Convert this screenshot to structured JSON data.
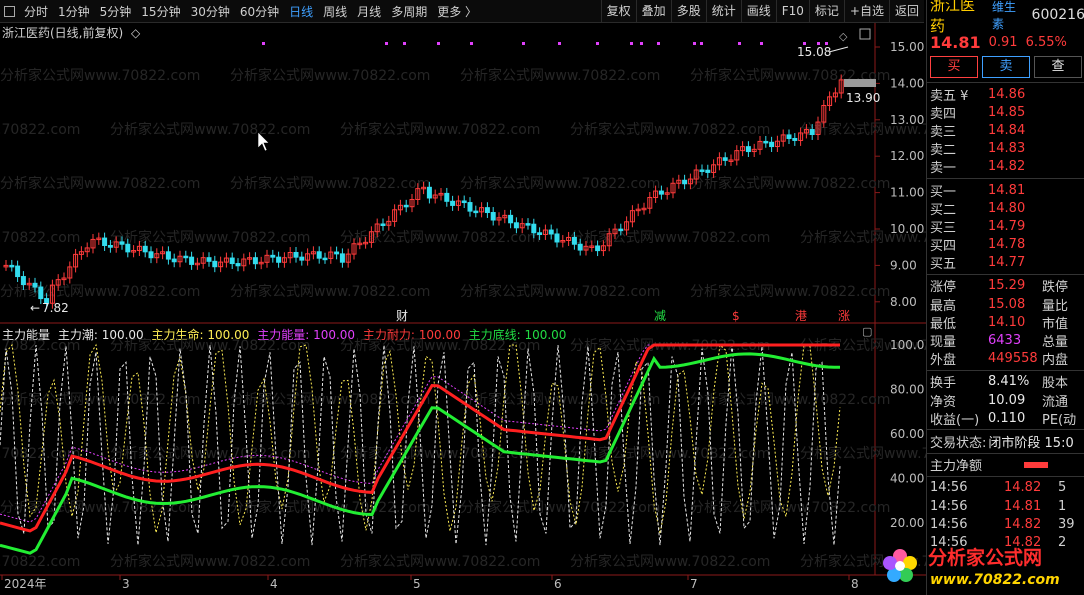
{
  "toolbar": {
    "timeframes": [
      "分时",
      "1分钟",
      "5分钟",
      "15分钟",
      "30分钟",
      "60分钟",
      "日线",
      "周线",
      "月线",
      "多周期",
      "更多 〉"
    ],
    "active_timeframe": "日线",
    "tools": [
      "复权",
      "叠加",
      "多股",
      "统计",
      "画线",
      "F10",
      "标记",
      "+自选",
      "返回"
    ]
  },
  "chart": {
    "title": "浙江医药(日线,前复权)",
    "price_axis": [
      "15.00",
      "14.00",
      "13.00",
      "12.00",
      "11.00",
      "10.00",
      "9.00",
      "8.00"
    ],
    "high_label": "15.08",
    "low_label": "7.82",
    "current_price_tag": "13.90",
    "event_markers": [
      {
        "label": "财",
        "color": "#e8e8e8"
      },
      {
        "label": "减",
        "color": "#22dd44"
      },
      {
        "label": "$",
        "color": "#ff3b3b"
      },
      {
        "label": "港",
        "color": "#ff3b3b"
      },
      {
        "label": "涨",
        "color": "#ff3b3b"
      }
    ],
    "x_labels": [
      "2024年",
      "3",
      "4",
      "5",
      "6",
      "7",
      "8"
    ]
  },
  "indicator": {
    "name": "主力能量",
    "legend": [
      {
        "label": "主力潮: 100.00",
        "color": "#e8e8e8"
      },
      {
        "label": "主力生命: 100.00",
        "color": "#ffee55"
      },
      {
        "label": "主力能量: 100.00",
        "color": "#e040fb"
      },
      {
        "label": "主力耐力: 100.00",
        "color": "#ff3b3b"
      },
      {
        "label": "主力底线: 100.00",
        "color": "#22dd44"
      }
    ],
    "axis": [
      "100.0",
      "80.00",
      "60.00",
      "40.00",
      "20.00"
    ]
  },
  "watermark": "分析家公式网www.70822.com",
  "quote": {
    "name": "浙江医药",
    "tag": "维生素",
    "code": "600216",
    "price": "14.81",
    "change": "0.91",
    "pct": "6.55%",
    "buy_label": "买",
    "sell_label": "卖",
    "query_label": "查",
    "asks": [
      {
        "label": "卖五 ¥",
        "price": "14.86"
      },
      {
        "label": "卖四",
        "price": "14.85"
      },
      {
        "label": "卖三",
        "price": "14.84"
      },
      {
        "label": "卖二",
        "price": "14.83"
      },
      {
        "label": "卖一",
        "price": "14.82"
      }
    ],
    "bids": [
      {
        "label": "买一",
        "price": "14.81"
      },
      {
        "label": "买二",
        "price": "14.80"
      },
      {
        "label": "买三",
        "price": "14.79"
      },
      {
        "label": "买四",
        "price": "14.78"
      },
      {
        "label": "买五",
        "price": "14.77"
      }
    ],
    "stats": [
      {
        "label": "涨停",
        "value": "15.29",
        "color": "red",
        "extra": "跌停"
      },
      {
        "label": "最高",
        "value": "15.08",
        "color": "red",
        "extra": "量比"
      },
      {
        "label": "最低",
        "value": "14.10",
        "color": "red",
        "extra": "市值"
      },
      {
        "label": "现量",
        "value": "6433",
        "color": "purple",
        "extra": "总量"
      },
      {
        "label": "外盘",
        "value": "449558",
        "color": "red",
        "extra": "内盘"
      }
    ],
    "stats2": [
      {
        "label": "换手",
        "value": "8.41%",
        "extra": "股本"
      },
      {
        "label": "净资",
        "value": "10.09",
        "extra": "流通"
      },
      {
        "label": "收益(一)",
        "value": "0.110",
        "extra": "PE(动"
      }
    ],
    "trade_status_label": "交易状态:",
    "trade_status": "闭市阶段 15:0",
    "net_flow_label": "主力净额",
    "ticks": [
      {
        "time": "14:56",
        "price": "14.82",
        "vol": "5"
      },
      {
        "time": "14:56",
        "price": "14.81",
        "vol": "1"
      },
      {
        "time": "14:56",
        "price": "14.82",
        "vol": "39"
      },
      {
        "time": "14:56",
        "price": "14.82",
        "vol": "2"
      }
    ],
    "logo_text": "分析家公式网",
    "logo_url": "www.70822.com"
  }
}
